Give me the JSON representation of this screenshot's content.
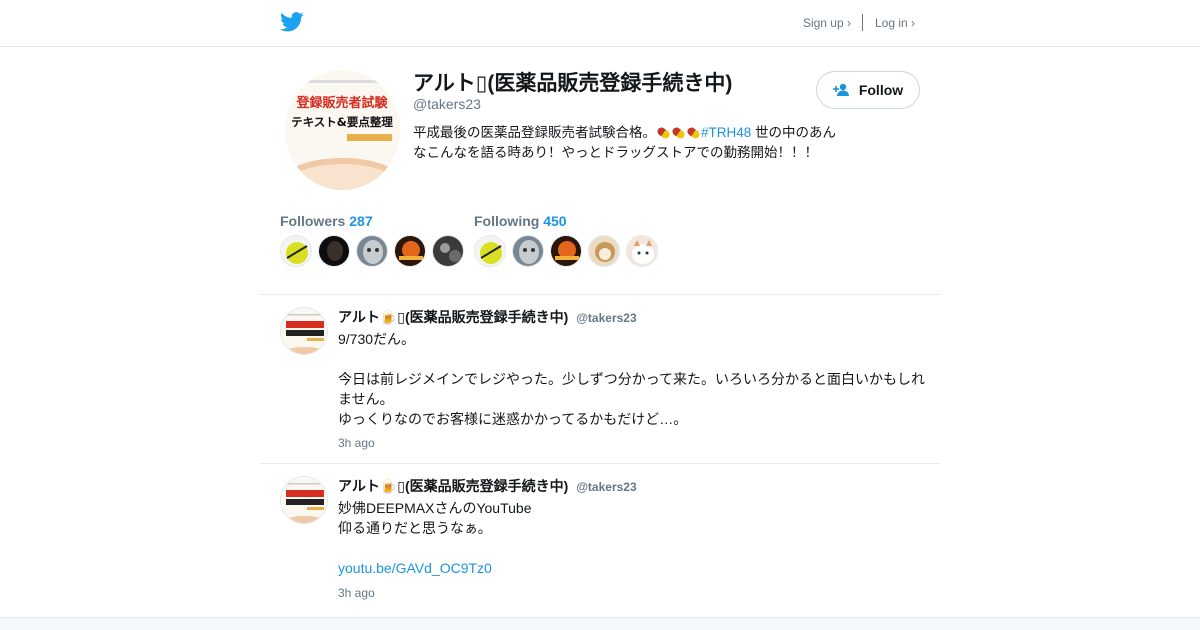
{
  "nav": {
    "signup_label": "Sign up ›",
    "login_label": "Log in ›"
  },
  "profile": {
    "name": "アルト▯(医薬品販売登録手続き中)",
    "handle": "@takers23",
    "bio_before": "平成最後の医薬品登録販売者試験合格。",
    "bio_hashtag": "#TRH48",
    "bio_after": " 世の中のあんなこんなを語る時あり！やっとドラッグストアでの勤務開始！！！",
    "follow_label": "Follow",
    "avatar_caption": [
      "登録販売者試験",
      "テキスト&要点整理"
    ]
  },
  "stats": {
    "followers_label": "Followers",
    "followers_count": "287",
    "following_label": "Following",
    "following_count": "450"
  },
  "tweets": [
    {
      "name": "アルト🍺▯(医薬品販売登録手続き中)",
      "handle": "@takers23",
      "line1": "9/730だん。",
      "line2": "今日は前レジメインでレジやった。少しずつ分かって来た。いろいろ分かると面白いかもしれません。",
      "line3": "ゆっくりなのでお客様に迷惑かかってるかもだけど…。",
      "time": "3h ago"
    },
    {
      "name": "アルト🍺▯(医薬品販売登録手続き中)",
      "handle": "@takers23",
      "line1": "妙佛DEEPMAXさんのYouTube",
      "line2": "仰る通りだと思うなぁ。",
      "link": "youtu.be/GAVd_OC9Tz0",
      "time": "3h ago"
    }
  ],
  "colors": {
    "accent": "#1b95e0",
    "bird": "#1da1f2",
    "muted": "#657786",
    "border": "#e6ecf0"
  },
  "icons": [
    "twitter-bird-icon",
    "follow-person-icon"
  ]
}
